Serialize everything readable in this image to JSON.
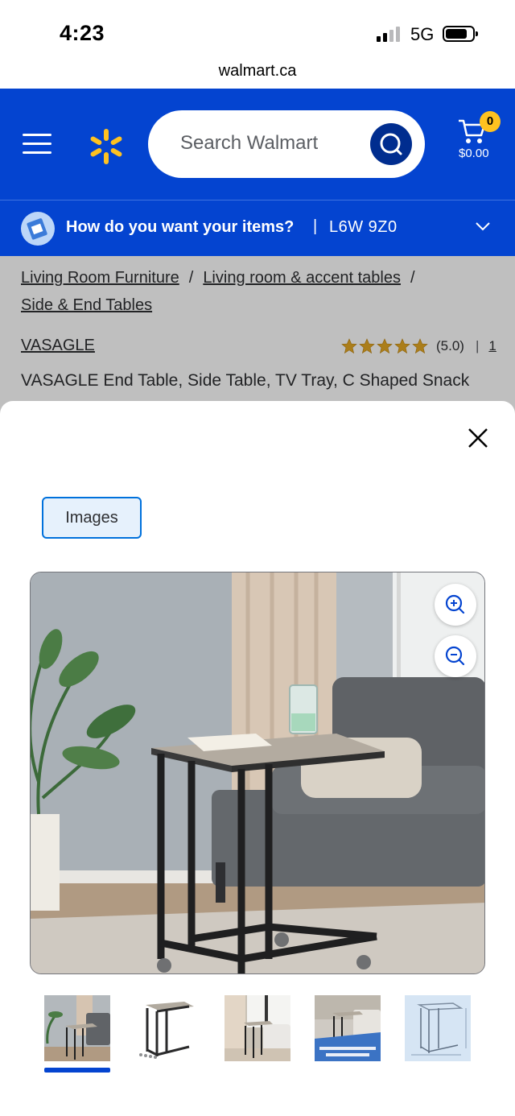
{
  "status_bar": {
    "time": "4:23",
    "network": "5G"
  },
  "browser": {
    "url": "walmart.ca"
  },
  "header": {
    "search_placeholder": "Search Walmart",
    "cart_count": "0",
    "cart_total": "$0.00",
    "brand_color": "#0444d0",
    "accent_color": "#ffc220"
  },
  "delivery": {
    "question": "How do you want your items?",
    "separator": "|",
    "postal_code": "L6W 9Z0"
  },
  "breadcrumb": {
    "items": [
      "Living Room Furniture",
      "Living room & accent tables",
      "Side & End Tables"
    ],
    "separator": "/"
  },
  "product": {
    "brand": "VASAGLE",
    "rating_text": "(5.0)",
    "rating_stars": 5,
    "rating_separator": "|",
    "review_count": "1",
    "title": "VASAGLE End Table, Side Table, TV Tray, C Shaped Snack"
  },
  "modal": {
    "tab_label": "Images",
    "selected_thumbnail": 1,
    "thumbnails": [
      {
        "icon": "room-scene-thumbnail"
      },
      {
        "icon": "product-only-thumbnail"
      },
      {
        "icon": "window-scene-thumbnail"
      },
      {
        "icon": "workstation-thumbnail",
        "caption": "Doubles as an Occasional Workstation"
      },
      {
        "icon": "dimensions-thumbnail"
      }
    ]
  }
}
